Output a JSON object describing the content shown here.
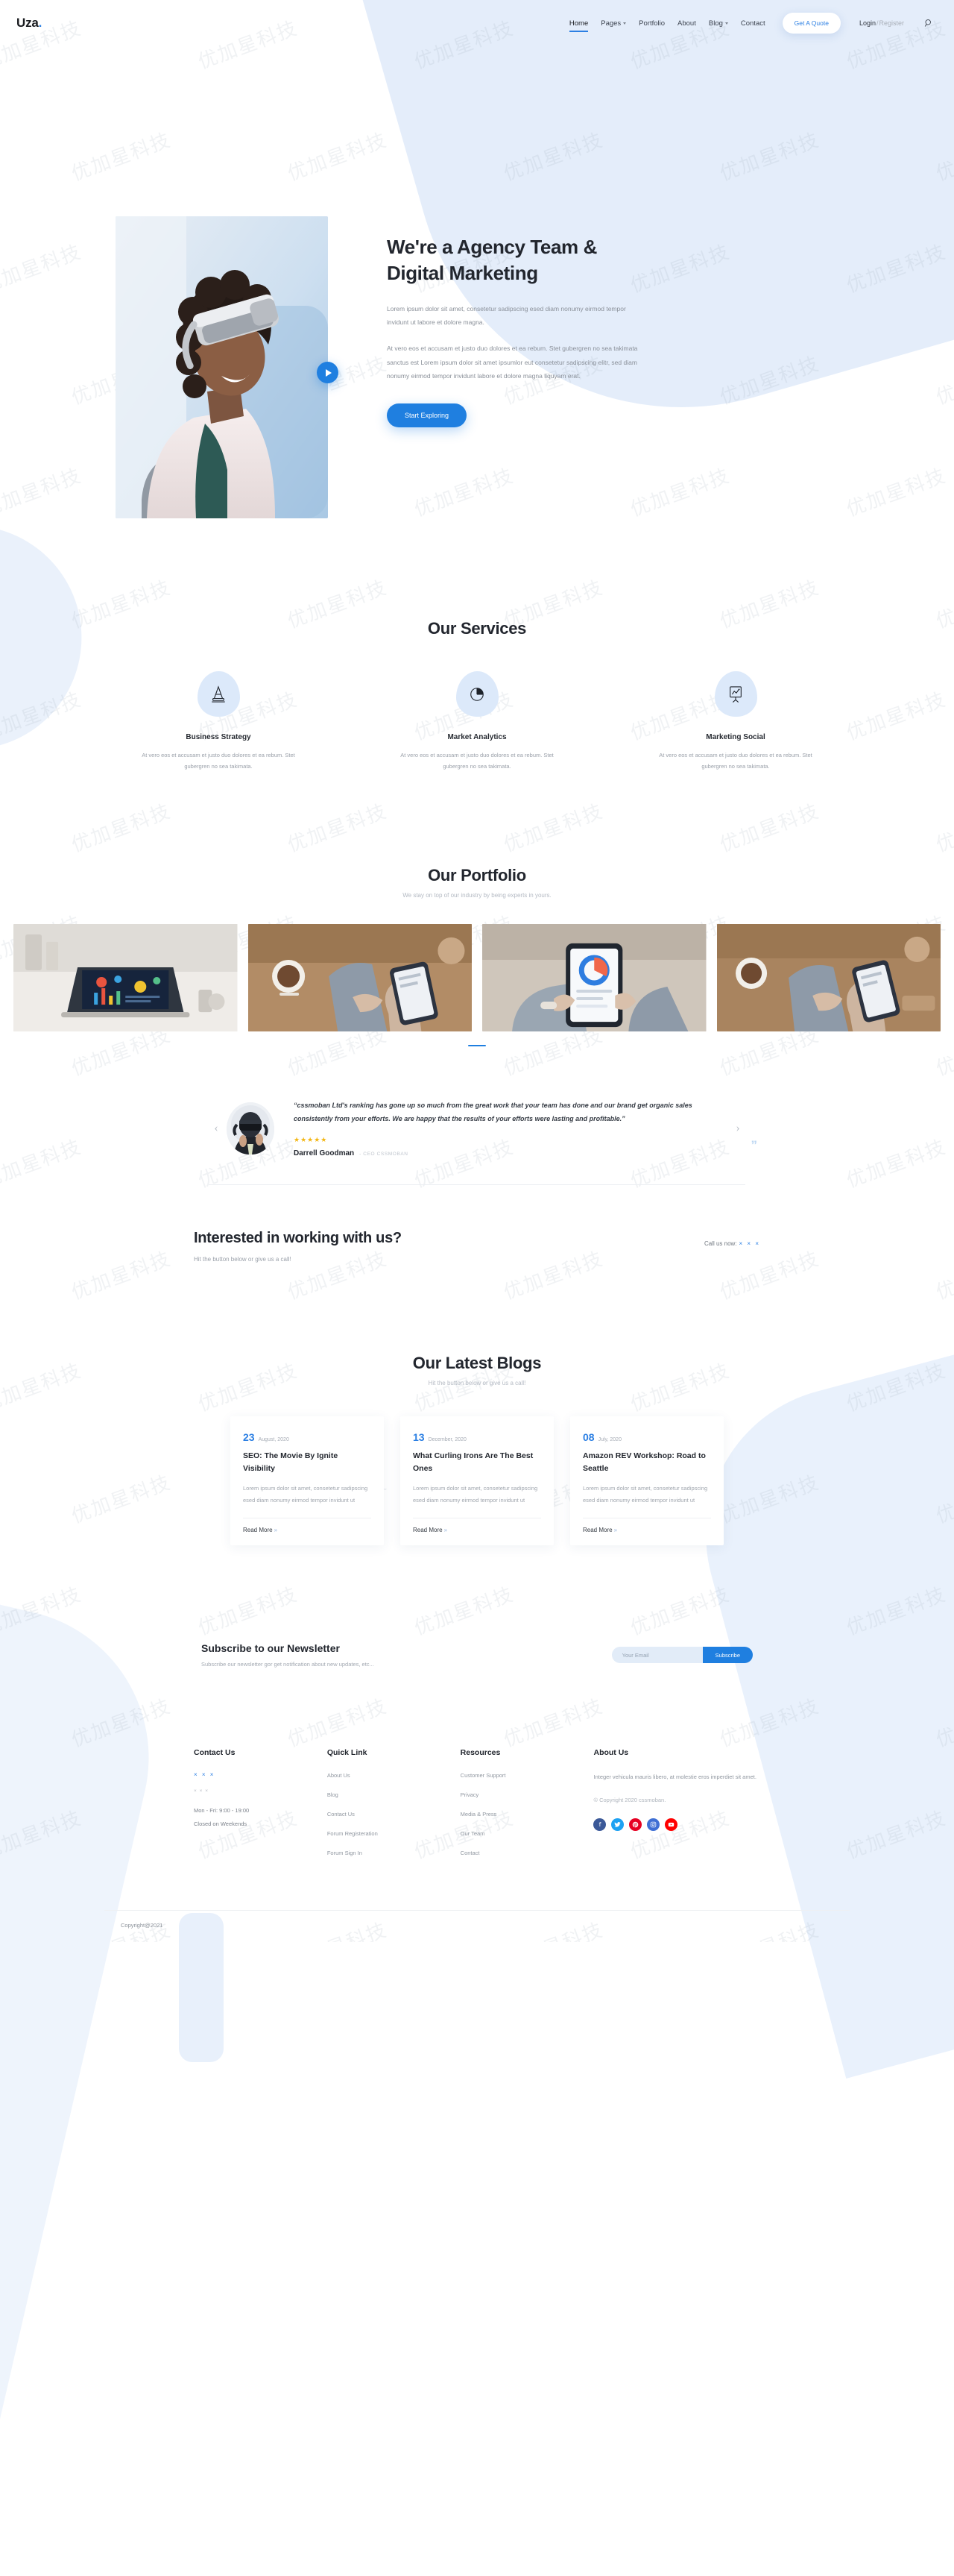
{
  "header": {
    "logo": "Uza",
    "logo_dot": ".",
    "nav": [
      {
        "label": "Home",
        "caret": false,
        "active": true
      },
      {
        "label": "Pages",
        "caret": true,
        "active": false
      },
      {
        "label": "Portfolio",
        "caret": false,
        "active": false
      },
      {
        "label": "About",
        "caret": false,
        "active": false
      },
      {
        "label": "Blog",
        "caret": true,
        "active": false
      },
      {
        "label": "Contact",
        "caret": false,
        "active": false
      }
    ],
    "quote_button": "Get A Quote",
    "login": "Login",
    "separator": "/",
    "register": "Register",
    "search_icon": "search-icon"
  },
  "hero": {
    "title_line1": "We're a Agency Team &",
    "title_line2": "Digital Marketing",
    "paragraph1": "Lorem ipsum dolor sit amet, consetetur sadipscing esed diam nonumy eirmod tempor invidunt ut labore et dolore magna.",
    "paragraph2": "At vero eos et accusam et justo duo dolores et ea rebum. Stet gubergren no sea takimata sanctus est Lorem ipsum dolor sit amet ipsumlor eut consetetur sadipscing elitr, sed diam nonumy eirmod tempor invidunt labore et dolore magna liquyam erat.",
    "cta_button": "Start Exploring",
    "play_icon": "play-icon"
  },
  "services": {
    "title": "Our Services",
    "items": [
      {
        "icon": "traffic-cone-icon",
        "name": "Business Strategy",
        "desc": "At vero eos et accusam et justo duo dolores et ea rebum. Stet gubergren no sea takimata."
      },
      {
        "icon": "pie-chart-icon",
        "name": "Market Analytics",
        "desc": "At vero eos et accusam et justo duo dolores et ea rebum. Stet gubergren no sea takimata."
      },
      {
        "icon": "presentation-chart-icon",
        "name": "Marketing Social",
        "desc": "At vero eos et accusam et justo duo dolores et ea rebum. Stet gubergren no sea takimata."
      }
    ]
  },
  "portfolio": {
    "title": "Our Portfolio",
    "subtitle": "We stay on top of our industry by being experts in yours.",
    "items": [
      {
        "alt": "laptop-with-charts-on-desk"
      },
      {
        "alt": "hands-holding-phone-with-coffee"
      },
      {
        "alt": "hands-holding-phone-analytics"
      },
      {
        "alt": "phone-and-coffee-on-wooden-desk"
      }
    ],
    "active_dot": 1
  },
  "testimonial": {
    "prev_icon": "chevron-left-icon",
    "next_icon": "chevron-right-icon",
    "avatar_alt": "person-wearing-vr-headset",
    "quote": "“cssmoban Ltd's ranking has gone up so much from the great work that your team has done and our brand get organic sales consistently from your efforts. We are happy that the results of your efforts were lasting and profitable.”",
    "stars": "★★★★★",
    "author": "Darrell Goodman",
    "role": "- CEO CSSMOBAN",
    "quote_mark": "”"
  },
  "cta": {
    "title": "Interested in working with us?",
    "subtitle": "Hit the button below or give us a call!",
    "call_label": "Call us now:",
    "phone": "× × ×"
  },
  "blogs": {
    "title": "Our Latest Blogs",
    "subtitle": "Hit the button below or give us a call!",
    "posts": [
      {
        "day": "23",
        "date": "August, 2020",
        "title": "SEO: The Movie By Ignite Visibility",
        "desc": "Lorem ipsum dolor sit amet, consetetur sadipscing esed diam nonumy eirmod tempor invidunt ut",
        "read_more": "Read More"
      },
      {
        "day": "13",
        "date": "December, 2020",
        "title": "What Curling Irons Are The Best Ones",
        "desc": "Lorem ipsum dolor sit amet, consetetur sadipscing esed diam nonumy eirmod tempor invidunt ut",
        "read_more": "Read More"
      },
      {
        "day": "08",
        "date": "July, 2020",
        "title": "Amazon REV Workshop: Road to Seattle",
        "desc": "Lorem ipsum dolor sit amet, consetetur sadipscing esed diam nonumy eirmod tempor invidunt ut",
        "read_more": "Read More"
      }
    ],
    "chevron": "»"
  },
  "newsletter": {
    "title": "Subscribe to our Newsletter",
    "subtitle": "Subscribe our newsletter gor get notification about new updates, etc...",
    "placeholder": "Your Email",
    "button": "Subscribe"
  },
  "footer": {
    "contact": {
      "head": "Contact Us",
      "phone": "× × ×",
      "email": "× × ×",
      "hours1": "Mon - Fri: 9:00 - 19:00",
      "hours2": "Closed on Weekends"
    },
    "quick_link": {
      "head": "Quick Link",
      "links": [
        "About Us",
        "Blog",
        "Contact Us",
        "Forum Registeration",
        "Forum Sign In"
      ]
    },
    "resources": {
      "head": "Resources",
      "links": [
        "Customer Support",
        "Privacy",
        "Media & Press",
        "Our Team",
        "Contact"
      ]
    },
    "about": {
      "head": "About Us",
      "text": "Integer vehicula mauris libero, at molestie eros imperdiet sit amet.",
      "copyright": "© Copyright 2020 cssmoban.",
      "social": [
        {
          "name": "facebook-icon",
          "glyph": "f",
          "color": "#3b5998"
        },
        {
          "name": "twitter-icon",
          "glyph": "❈",
          "color": "#1da1f2"
        },
        {
          "name": "pinterest-icon",
          "glyph": "Ⓟ",
          "color": "#e60023"
        },
        {
          "name": "instagram-icon",
          "glyph": "▣",
          "color": "#3f6fd4"
        },
        {
          "name": "youtube-icon",
          "glyph": "▶",
          "color": "#ff0000"
        }
      ]
    },
    "bottom_copyright": "Copyright@2021"
  },
  "colors": {
    "accent": "#1f7fe0",
    "accent_light": "#2b7fe3",
    "bg_blue": "#e4edfa",
    "star": "#f3b715"
  }
}
